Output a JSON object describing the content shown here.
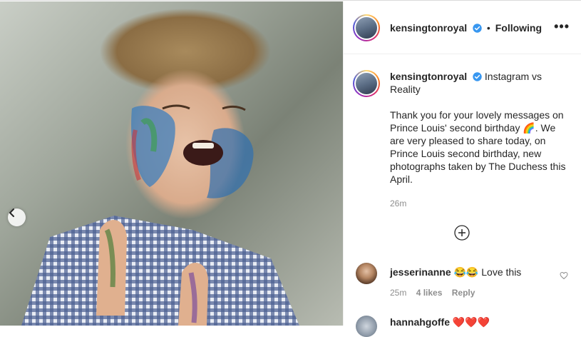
{
  "header": {
    "username": "kensingtonroyal",
    "separator": "•",
    "follow_status": "Following",
    "more_label": "•••"
  },
  "caption": {
    "username": "kensingtonroyal",
    "title": "Instagram vs Reality",
    "body": "Thank you for your lovely messages on Prince Louis' second birthday 🌈. We are very pleased to share today, on Prince Louis second birthday, new photographs taken by The Duchess this April.",
    "time": "26m"
  },
  "comments": [
    {
      "username": "jesserinanne",
      "emoji": "😂😂",
      "text": "Love this",
      "time": "25m",
      "likes": "4 likes",
      "reply": "Reply"
    },
    {
      "username": "hannahgoffe",
      "emoji": "❤️❤️❤️"
    }
  ],
  "colors": {
    "verified": "#3897f0",
    "text": "#262626",
    "muted": "#8e8e8e"
  },
  "icons": {
    "prev": "chevron-left-icon",
    "add": "plus-circle-icon",
    "like": "heart-icon",
    "verified": "verified-badge-icon"
  }
}
